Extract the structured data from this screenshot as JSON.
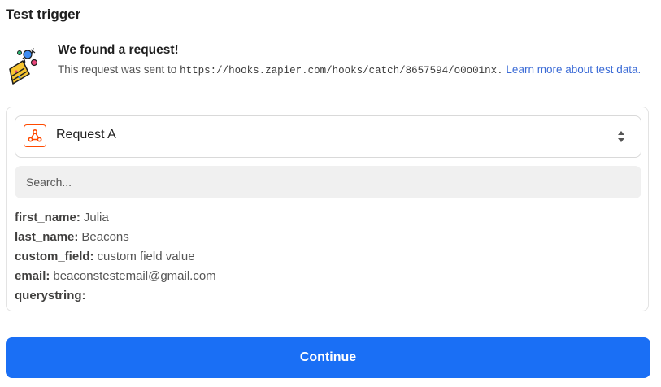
{
  "header": {
    "title": "Test trigger"
  },
  "found": {
    "title": "We found a request!",
    "desc_prefix": "This request was sent to ",
    "url": "https://hooks.zapier.com/hooks/catch/8657594/o0o01nx.",
    "link_text": "Learn more about test data",
    "desc_suffix": ".",
    "icon": "party-popper-icon"
  },
  "request_select": {
    "value": "Request A",
    "icon": "webhook-icon",
    "accent_color": "#ff4a00"
  },
  "search": {
    "placeholder": "Search..."
  },
  "fields": [
    {
      "key": "first_name:",
      "value": "Julia"
    },
    {
      "key": "last_name:",
      "value": "Beacons"
    },
    {
      "key": "custom_field:",
      "value": "custom field value"
    },
    {
      "key": "email:",
      "value": "beaconstestemail@gmail.com"
    },
    {
      "key": "querystring:",
      "value": ""
    }
  ],
  "footer": {
    "continue_label": "Continue",
    "button_color": "#1a6ff5"
  }
}
